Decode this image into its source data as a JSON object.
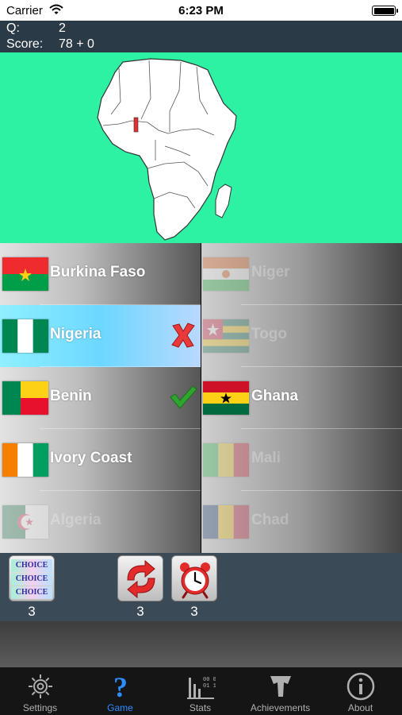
{
  "status_bar": {
    "carrier": "Carrier",
    "time": "6:23 PM"
  },
  "header": {
    "q_label": "Q:",
    "q_value": "2",
    "score_label": "Score:",
    "score_value": "78 + 0"
  },
  "map": {
    "background_color": "#2df2a3",
    "highlight_color": "#e03030"
  },
  "answers": [
    {
      "name": "Burkina Faso",
      "state": "normal",
      "mark": ""
    },
    {
      "name": "Niger",
      "state": "dim",
      "mark": ""
    },
    {
      "name": "Nigeria",
      "state": "selected",
      "mark": "wrong-x-icon"
    },
    {
      "name": "Togo",
      "state": "dim",
      "mark": ""
    },
    {
      "name": "Benin",
      "state": "normal",
      "mark": "correct-check-icon"
    },
    {
      "name": "Ghana",
      "state": "normal",
      "mark": ""
    },
    {
      "name": "Ivory Coast",
      "state": "normal",
      "mark": ""
    },
    {
      "name": "Mali",
      "state": "dim",
      "mark": ""
    },
    {
      "name": "Algeria",
      "state": "dim",
      "mark": ""
    },
    {
      "name": "Chad",
      "state": "dim",
      "mark": ""
    }
  ],
  "powerups": {
    "choice": {
      "label": "CHOICE",
      "count": "3"
    },
    "refresh": {
      "count": "3"
    },
    "timer": {
      "count": "3"
    }
  },
  "tabs": [
    {
      "label": "Settings",
      "icon": "gear-icon",
      "active": false
    },
    {
      "label": "Game",
      "icon": "question-mark-icon",
      "active": true
    },
    {
      "label": "Stats",
      "icon": "stats-icon",
      "active": false
    },
    {
      "label": "Achievements",
      "icon": "trophy-icon",
      "active": false
    },
    {
      "label": "About",
      "icon": "info-icon",
      "active": false
    }
  ],
  "colors": {
    "tab_active": "#2b8cff",
    "tab_inactive": "#b0b0b0",
    "header_bg": "#2b3a47"
  }
}
